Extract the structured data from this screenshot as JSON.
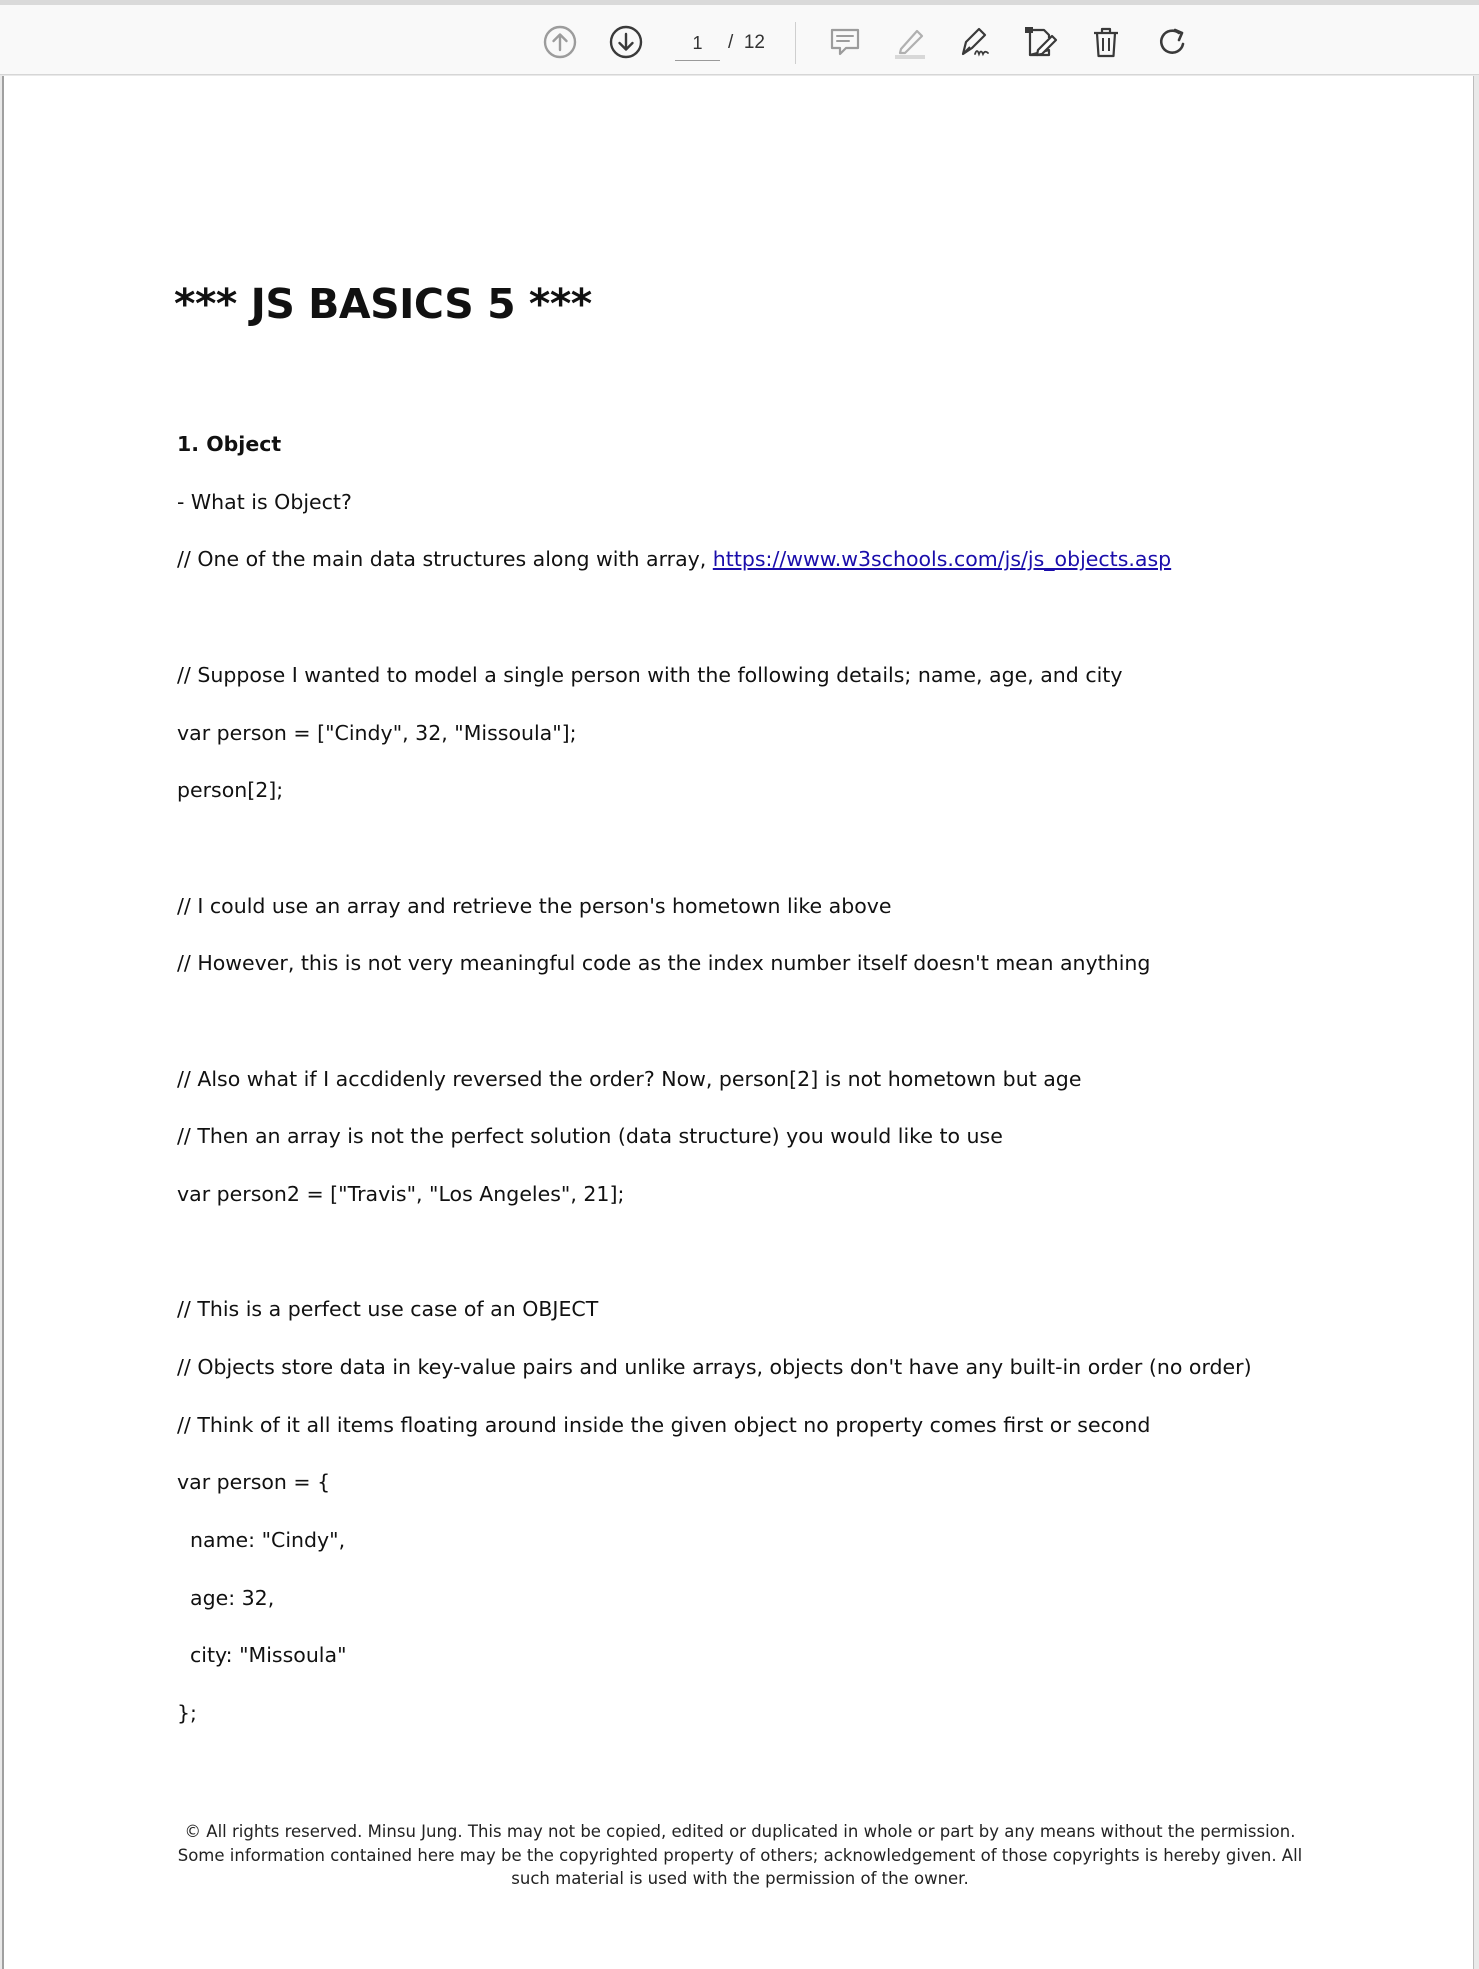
{
  "toolbar": {
    "icons": [
      "prev-page-icon",
      "next-page-icon",
      "comment-icon",
      "highlight-icon",
      "sign-icon",
      "edit-icon",
      "delete-icon",
      "rotate-icon"
    ],
    "current_page": "1",
    "total_pages": "/  12"
  },
  "document": {
    "title": "*** JS BASICS 5 ***",
    "heading": "1. Object",
    "lines": {
      "what_is": "- What is Object?",
      "one_of_prefix": "// One of the main data structures along with array, ",
      "link": "https://www.w3schools.com/js/js_objects.asp",
      "suppose": "// Suppose I wanted to model a single person with the following details; name, age, and city",
      "var_person_array": "var person = [\"Cindy\", 32, \"Missoula\"];",
      "person_index": "person[2];",
      "could_use": "// I could use an array and retrieve the person's hometown like above",
      "however": "// However, this is not very meaningful code as the index number itself doesn't mean anything",
      "also_what_if": "// Also what if I accdidenly reversed the order? Now, person[2] is not hometown but age",
      "then_array": "// Then an array is not the perfect solution (data structure) you would like to use",
      "var_person2": "var person2 = [\"Travis\", \"Los Angeles\", 21];",
      "perfect_use": "// This is a perfect use case of an OBJECT",
      "objects_store": "// Objects store data in key-value pairs and unlike arrays, objects don't have any built-in order (no order)",
      "think_of": "// Think of it all items floating around inside the given object no property comes first or second",
      "obj_open": "var person = {",
      "obj_name": "  name: \"Cindy\",",
      "obj_age": "  age: 32,",
      "obj_city": "  city: \"Missoula\"",
      "obj_close": "};"
    },
    "footer": "© All rights reserved. Minsu Jung. This may not be copied, edited or duplicated in whole or part by any means without the permission. Some information contained here may be the copyrighted property of others; acknowledgement of those copyrights is hereby given. All such material is used with the permission of the owner."
  }
}
